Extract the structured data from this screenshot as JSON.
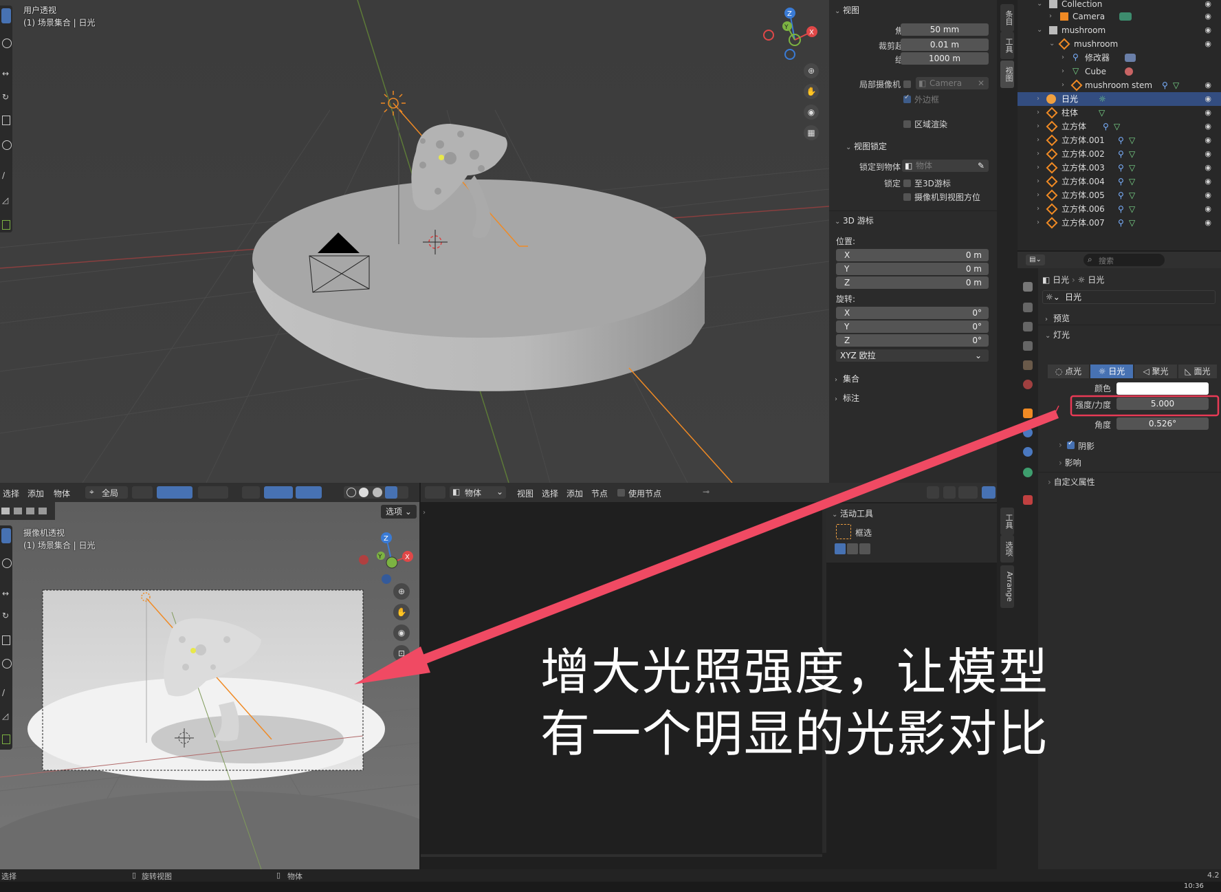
{
  "viewport_top": {
    "title": "用户透视",
    "subtitle": "(1) 场景集合 | 日光"
  },
  "npanel": {
    "tabs": [
      "条目",
      "工具",
      "视图"
    ],
    "view_section": "视图",
    "focal_label": "焦距",
    "focal_value": "50 mm",
    "clip_start_label": "裁剪起始",
    "clip_start_value": "0.01 m",
    "clip_end_label": "结束",
    "clip_end_value": "1000 m",
    "local_camera_label": "局部摄像机",
    "local_camera_value": "Camera",
    "border_label": "外边框",
    "region_render_label": "区域渲染",
    "lock_section": "视图锁定",
    "lock_to_object_label": "锁定到物体",
    "lock_to_object_placeholder": "物体",
    "lock_label": "锁定",
    "to_3d_cursor": "至3D游标",
    "camera_to_view": "摄像机到视图方位",
    "cursor_section": "3D 游标",
    "location_label": "位置:",
    "loc": [
      {
        "axis": "X",
        "value": "0 m"
      },
      {
        "axis": "Y",
        "value": "0 m"
      },
      {
        "axis": "Z",
        "value": "0 m"
      }
    ],
    "rotation_label": "旋转:",
    "rot": [
      {
        "axis": "X",
        "value": "0°"
      },
      {
        "axis": "Y",
        "value": "0°"
      },
      {
        "axis": "Z",
        "value": "0°"
      }
    ],
    "rot_mode": "XYZ 欧拉",
    "collection_section": "集合",
    "annotation_section": "标注"
  },
  "outliner": {
    "rows": [
      {
        "label": "Collection"
      },
      {
        "label": "Camera"
      },
      {
        "label": "mushroom"
      },
      {
        "label": "mushroom"
      },
      {
        "label": "修改器"
      },
      {
        "label": "Cube"
      },
      {
        "label": "mushroom stem"
      },
      {
        "label": "日光"
      },
      {
        "label": "柱体"
      },
      {
        "label": "立方体"
      },
      {
        "label": "立方体.001"
      },
      {
        "label": "立方体.002"
      },
      {
        "label": "立方体.003"
      },
      {
        "label": "立方体.004"
      },
      {
        "label": "立方体.005"
      },
      {
        "label": "立方体.006"
      },
      {
        "label": "立方体.007"
      }
    ]
  },
  "properties": {
    "search_placeholder": "搜索",
    "breadcrumb_object": "日光",
    "breadcrumb_data": "日光",
    "datablock_name": "日光",
    "preview_section": "预览",
    "light_section": "灯光",
    "light_types": [
      "点光",
      "日光",
      "聚光",
      "面光"
    ],
    "active_light_type": "日光",
    "color_label": "颜色",
    "strength_label": "强度/力度",
    "strength_value": "5.000",
    "angle_label": "角度",
    "angle_value": "0.526°",
    "shadow_label": "阴影",
    "influence_label": "影响",
    "custom_props": "自定义属性"
  },
  "header_bottom": {
    "menus": [
      "选择",
      "添加",
      "物体"
    ],
    "transform_space": "全局",
    "options": "选项"
  },
  "viewport_bottom": {
    "title": "摄像机透视",
    "subtitle": "(1) 场景集合 | 日光"
  },
  "header_mid": {
    "mode": "物体",
    "menus": [
      "视图",
      "选择",
      "添加",
      "节点"
    ],
    "use_nodes": "使用节点"
  },
  "tool_panel": {
    "section": "活动工具",
    "tool_name": "框选",
    "tabs": [
      "工具",
      "选项",
      "Arrange"
    ]
  },
  "status": {
    "select": "选择",
    "rotate_view": "旋转视图",
    "object": "物体",
    "version": "4.2",
    "clock": "10:36"
  },
  "annotation": {
    "line1": "增大光照强度，让模型",
    "line2": "有一个明显的光影对比",
    "arrow_color": "#f04a63",
    "highlight_color": "#e83a55"
  },
  "colors": {
    "accent": "#4772b3",
    "selection_row": "#334d80",
    "light_orange": "#f08a24",
    "axis_red": "#e04848",
    "axis_green": "#7cb342",
    "axis_blue": "#3a7bd5"
  }
}
